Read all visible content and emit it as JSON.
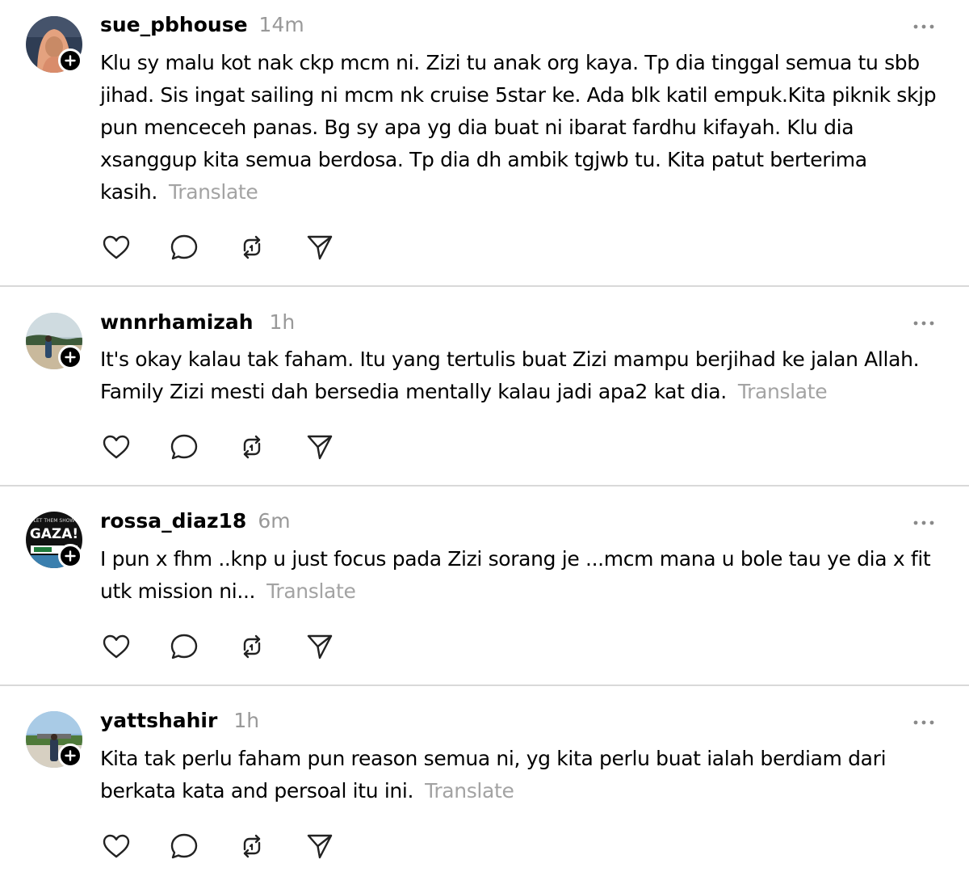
{
  "posts": [
    {
      "username": "sue_pbhouse",
      "time": "14m",
      "text": "Klu sy malu kot nak ckp mcm ni. Zizi tu anak org kaya. Tp dia tinggal semua tu sbb jihad. Sis ingat sailing ni mcm nk cruise 5star ke. Ada blk katil empuk.Kita piknik skjp pun menceceh panas. Bg sy apa yg dia buat ni ibarat fardhu kifayah. Klu dia xsanggup kita semua berdosa. Tp dia dh ambik tgjwb tu. Kita patut berterima kasih.",
      "translate": "Translate"
    },
    {
      "username": "wnnrhamizah",
      "time": "1h",
      "text": "It's okay kalau tak faham. Itu yang tertulis buat Zizi mampu berjihad ke jalan Allah. Family Zizi mesti dah bersedia mentally kalau jadi apa2 kat dia.",
      "translate": "Translate"
    },
    {
      "username": "rossa_diaz18",
      "time": "6m",
      "text": "I pun x fhm ..knp u just focus pada Zizi sorang je ...mcm mana u bole tau ye dia x fit utk mission ni...",
      "translate": "Translate",
      "avatar_text": "GAZA!",
      "avatar_small_text": "LET THEM SHOW"
    },
    {
      "username": "yattshahir",
      "time": "1h",
      "text": "Kita tak perlu faham pun reason semua ni, yg kita perlu buat ialah berdiam dari berkata kata and persoal itu ini.",
      "translate": "Translate"
    }
  ],
  "icons": {
    "like": "heart-icon",
    "reply": "comment-icon",
    "repost": "repost-icon",
    "share": "send-icon",
    "more": "more-icon",
    "follow": "plus-icon"
  },
  "colors": {
    "text": "#000000",
    "muted": "#999999",
    "divider": "#d9d9d9",
    "badge": "#000000"
  }
}
